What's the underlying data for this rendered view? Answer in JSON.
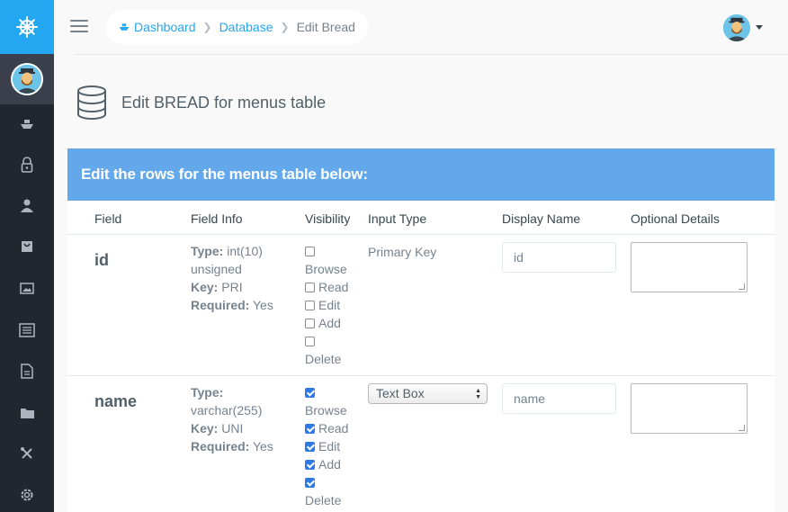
{
  "sidebar": {
    "brand_icon": "ship-wheel-icon",
    "icons": [
      "boat-icon",
      "lock-icon",
      "user-icon",
      "shopping-bag-icon",
      "image-icon",
      "news-icon",
      "document-icon",
      "folder-icon",
      "tools-icon",
      "settings-icon"
    ]
  },
  "breadcrumb": {
    "dashboard": "Dashboard",
    "database": "Database",
    "current": "Edit Bread"
  },
  "page": {
    "title": "Edit BREAD for menus table"
  },
  "panel": {
    "title": "Edit the rows for the menus table below:",
    "columns": {
      "field": "Field",
      "field_info": "Field Info",
      "visibility": "Visibility",
      "input_type": "Input Type",
      "display_name": "Display Name",
      "optional_details": "Optional Details"
    }
  },
  "labels": {
    "type": "Type:",
    "key": "Key:",
    "required": "Required:",
    "browse": "Browse",
    "read": "Read",
    "edit": "Edit",
    "add": "Add",
    "delete": "Delete"
  },
  "rows": [
    {
      "field": "id",
      "type_value": "int(10)",
      "type_extra": "unsigned",
      "key": "PRI",
      "required": "Yes",
      "visibility": {
        "browse": false,
        "read": false,
        "edit": false,
        "add": false,
        "delete": false
      },
      "input_type": "Primary Key",
      "display_name": "id",
      "optional_details": ""
    },
    {
      "field": "name",
      "type_value": "",
      "type_extra": "varchar(255)",
      "key": "UNI",
      "required": "Yes",
      "visibility": {
        "browse": true,
        "read": true,
        "edit": true,
        "add": true,
        "delete": true
      },
      "input_type": "Text Box",
      "display_name": "name",
      "optional_details": ""
    }
  ],
  "colors": {
    "brand": "#22a7f0",
    "sidebar": "#22262f",
    "panel_header": "#62a8ea",
    "checkbox_checked": "#2c7be5"
  }
}
